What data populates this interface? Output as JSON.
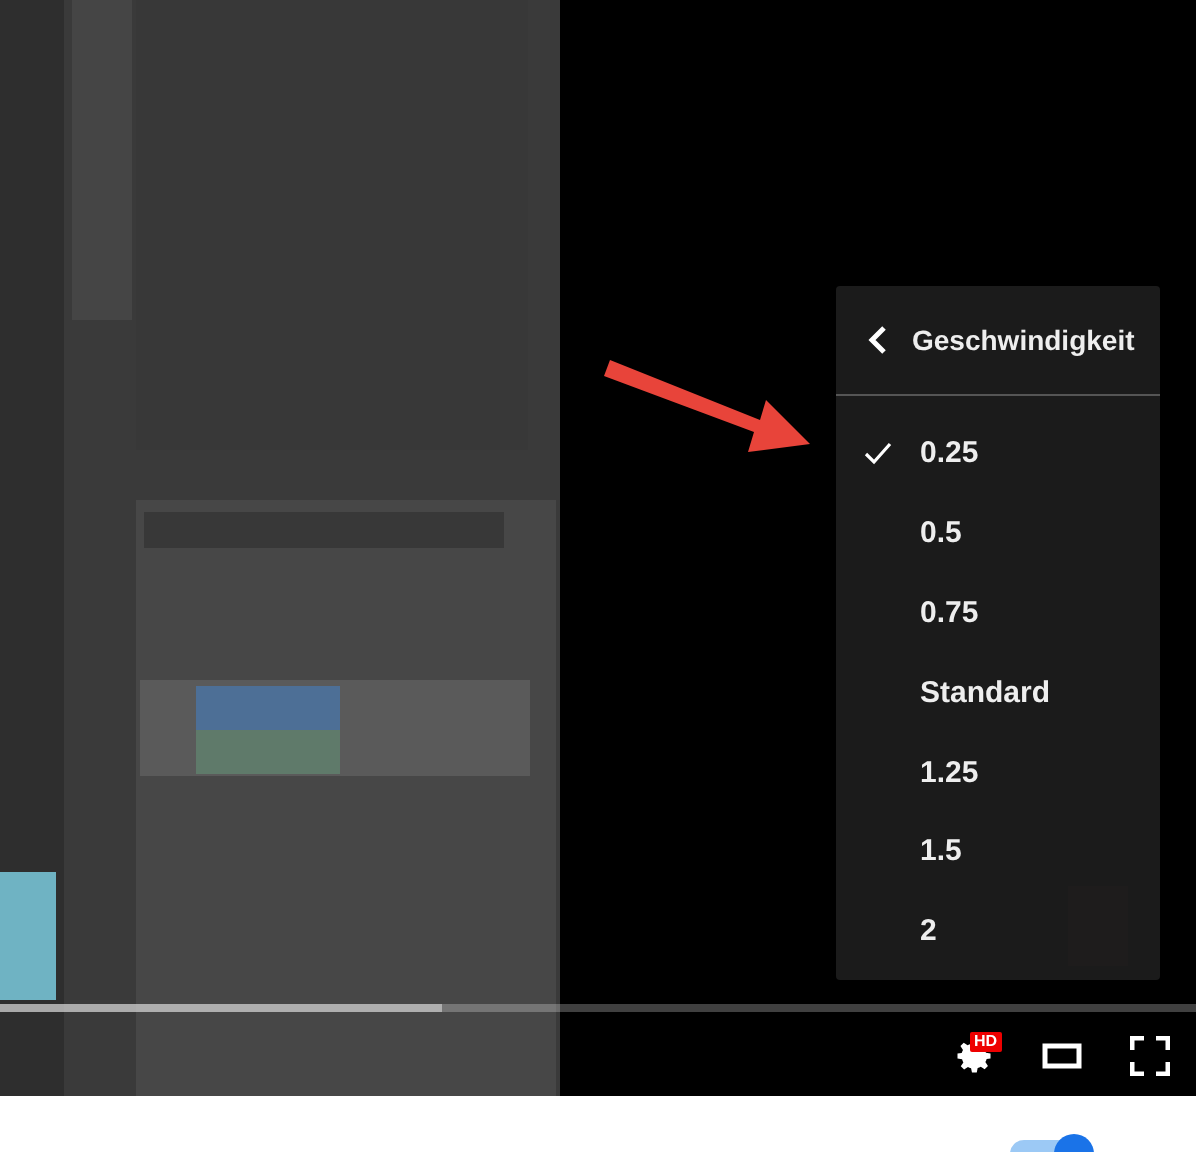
{
  "speed_menu": {
    "title": "Geschwindigkeit",
    "options": [
      {
        "label": "0.25",
        "selected": true
      },
      {
        "label": "0.5",
        "selected": false
      },
      {
        "label": "0.75",
        "selected": false
      },
      {
        "label": "Standard",
        "selected": false
      },
      {
        "label": "1.25",
        "selected": false
      },
      {
        "label": "1.5",
        "selected": false
      },
      {
        "label": "2",
        "selected": false
      }
    ]
  },
  "progress": {
    "level": 0.37
  },
  "controls": {
    "quality_badge": "HD"
  },
  "autoplay_toggle": {
    "on": true
  }
}
